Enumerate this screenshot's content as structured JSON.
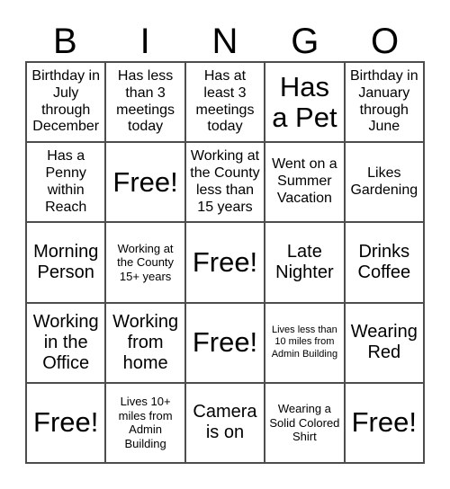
{
  "card": {
    "title": "BINGO",
    "header_letters": [
      "B",
      "I",
      "N",
      "G",
      "O"
    ],
    "grid": {
      "columns": 5,
      "rows": 5,
      "border_color": "#4d4d4d",
      "cell_background": "#ffffff",
      "text_color": "#000000"
    },
    "cells": [
      {
        "id": "b1",
        "text": "Birthday in July through December",
        "size": "md",
        "free": false
      },
      {
        "id": "i1",
        "text": "Has less than 3 meetings today",
        "size": "md",
        "free": false
      },
      {
        "id": "n1",
        "text": "Has at least 3 meetings today",
        "size": "md",
        "free": false
      },
      {
        "id": "g1",
        "text": "Has a Pet",
        "size": "xl",
        "free": false
      },
      {
        "id": "o1",
        "text": "Birthday in January through June",
        "size": "md",
        "free": false
      },
      {
        "id": "b2",
        "text": "Has a Penny within Reach",
        "size": "md",
        "free": false
      },
      {
        "id": "i2",
        "text": "Free!",
        "size": "xl",
        "free": true
      },
      {
        "id": "n2",
        "text": "Working at the County less than 15 years",
        "size": "md",
        "free": false
      },
      {
        "id": "g2",
        "text": "Went on a Summer Vacation",
        "size": "md",
        "free": false
      },
      {
        "id": "o2",
        "text": "Likes Gardening",
        "size": "md",
        "free": false
      },
      {
        "id": "b3",
        "text": "Morning Person",
        "size": "lg",
        "free": false
      },
      {
        "id": "i3",
        "text": "Working at the County 15+ years",
        "size": "sm",
        "free": false
      },
      {
        "id": "n3",
        "text": "Free!",
        "size": "xl",
        "free": true
      },
      {
        "id": "g3",
        "text": "Late Nighter",
        "size": "lg",
        "free": false
      },
      {
        "id": "o3",
        "text": "Drinks Coffee",
        "size": "lg",
        "free": false
      },
      {
        "id": "b4",
        "text": "Working in the Office",
        "size": "lg",
        "free": false
      },
      {
        "id": "i4",
        "text": "Working from home",
        "size": "lg",
        "free": false
      },
      {
        "id": "n4",
        "text": "Free!",
        "size": "xl",
        "free": true
      },
      {
        "id": "g4",
        "text": "Lives less than 10 miles from Admin Building",
        "size": "xs",
        "free": false
      },
      {
        "id": "o4",
        "text": "Wearing Red",
        "size": "lg",
        "free": false
      },
      {
        "id": "b5",
        "text": "Free!",
        "size": "xl",
        "free": true
      },
      {
        "id": "i5",
        "text": "Lives 10+ miles from Admin Building",
        "size": "sm",
        "free": false
      },
      {
        "id": "n5",
        "text": "Camera is on",
        "size": "lg",
        "free": false
      },
      {
        "id": "g5",
        "text": "Wearing a Solid Colored Shirt",
        "size": "sm",
        "free": false
      },
      {
        "id": "o5",
        "text": "Free!",
        "size": "xl",
        "free": true
      }
    ]
  }
}
